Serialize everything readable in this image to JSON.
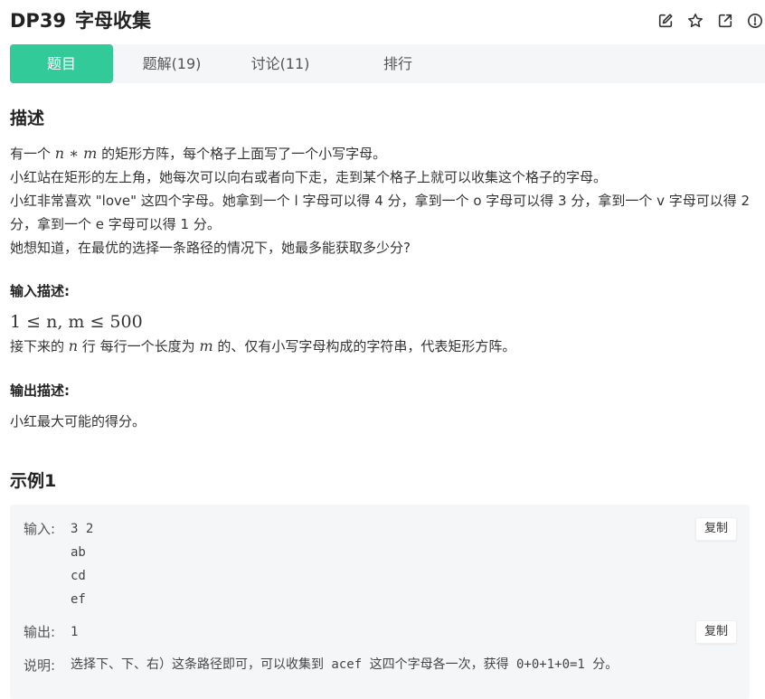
{
  "header": {
    "code": "DP39",
    "title": "字母收集"
  },
  "tabs": [
    {
      "label": "题目"
    },
    {
      "label": "题解(19)"
    },
    {
      "label": "讨论(11)"
    },
    {
      "label": "排行"
    }
  ],
  "description": {
    "title": "描述",
    "line1_pre": "有一个",
    "line1_math": "n ∗ m",
    "line1_post": "的矩形方阵，每个格子上面写了一个小写字母。",
    "line2": "小红站在矩形的左上角，她每次可以向右或者向下走，走到某个格子上就可以收集这个格子的字母。",
    "line3": "小红非常喜欢 \"love\" 这四个字母。她拿到一个 l 字母可以得 4 分，拿到一个 o 字母可以得 3 分，拿到一个 v 字母可以得 2 分，拿到一个 e 字母可以得 1 分。",
    "line4": "她想知道，在最优的选择一条路径的情况下，她最多能获取多少分?"
  },
  "input_desc": {
    "title": "输入描述:",
    "constraint": "1 ≤ n, m ≤ 500",
    "line_pre": "接下来的",
    "line_math_n": "n",
    "line_mid": "行 每行一个长度为",
    "line_math_m": "m",
    "line_post": "的、仅有小写字母构成的字符串，代表矩形方阵。"
  },
  "output_desc": {
    "title": "输出描述:",
    "text": "小红最大可能的得分。"
  },
  "example": {
    "title": "示例1",
    "input_label": "输入:",
    "input_lines": "3 2\nab\ncd\nef",
    "output_label": "输出:",
    "output_value": "1",
    "explain_label": "说明:",
    "explain_text": "选择下、下、右）这条路径即可，可以收集到 acef 这四个字母各一次，获得 0+0+1+0=1 分。",
    "copy_label": "复制"
  },
  "icons": [
    "edit-icon",
    "star-icon",
    "share-icon",
    "report-icon"
  ],
  "colors": {
    "accent": "#32ca99",
    "tab_bar": "#f5f6f8"
  }
}
